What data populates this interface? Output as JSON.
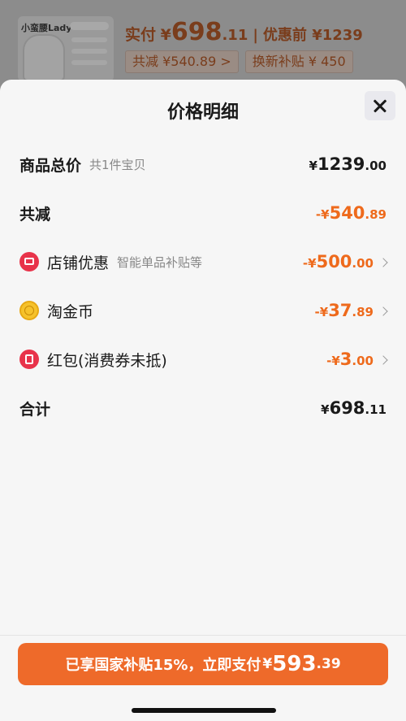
{
  "background": {
    "product_title": "小蛮腰Lady",
    "paid_label": "实付",
    "paid_symbol": "¥",
    "paid_int": "698",
    "paid_dec": ".11",
    "separator": "|",
    "before_discount": "优惠前 ¥1239",
    "chip_total_reduce": "共减 ¥540.89 >",
    "chip_trade_in": "换新补贴 ¥ 450"
  },
  "sheet": {
    "title": "价格明细",
    "rows": {
      "total": {
        "label": "商品总价",
        "sub": "共1件宝贝",
        "sign": "¥",
        "int": "1239",
        "dec": ".00"
      },
      "reduce": {
        "label": "共减",
        "sign": "-¥",
        "int": "540",
        "dec": ".89"
      },
      "shop": {
        "label": "店铺优惠",
        "sub": "智能单品补贴等",
        "sign": "-¥",
        "int": "500",
        "dec": ".00"
      },
      "coin": {
        "label": "淘金币",
        "sign": "-¥",
        "int": "37",
        "dec": ".89"
      },
      "redpack": {
        "label": "红包(消费券未抵)",
        "sign": "-¥",
        "int": "3",
        "dec": ".00"
      },
      "sum": {
        "label": "合计",
        "sign": "¥",
        "int": "698",
        "dec": ".11"
      }
    }
  },
  "pay_button": {
    "text": "已享国家补贴15%，立即支付",
    "symbol": "¥",
    "int": "593",
    "dec": ".39"
  },
  "colors": {
    "accent": "#ee6a2a",
    "discount": "#ee6a1c"
  }
}
